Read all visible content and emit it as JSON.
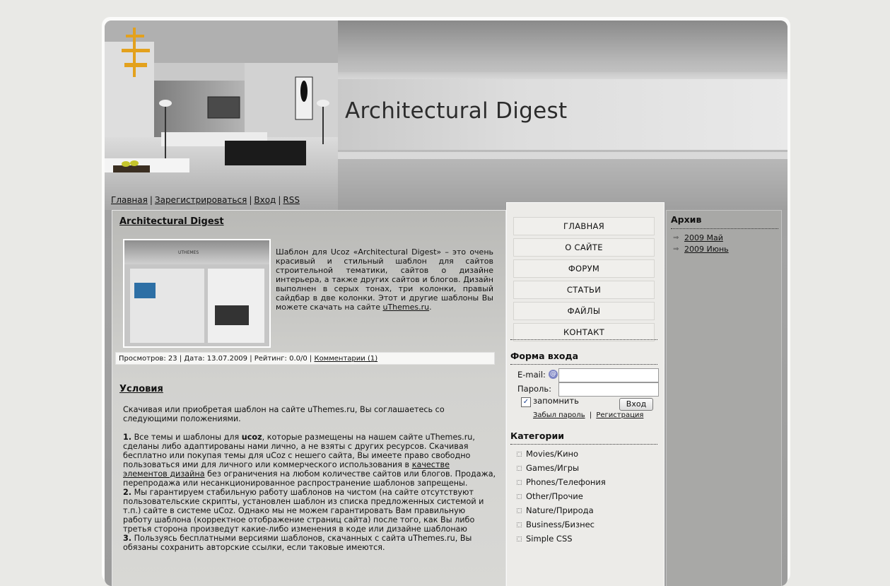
{
  "site": {
    "title": "Architectural Digest"
  },
  "topnav": {
    "items": [
      "Главная",
      "Зарегистрироваться",
      "Вход",
      "RSS"
    ],
    "sep": "|"
  },
  "entry": {
    "title": "Architectural Digest",
    "thumb_label": "UTHEMES",
    "text": "Шаблон для Ucoz «Architectural Digest» – это очень красивый и стильный шаблон для сайтов строительной тематики, сайтов о дизайне интерьера, а также других сайтов и блогов. Дизайн выполнен в серых тонах, три колонки, правый сайдбар в две колонки. Этот и другие шаблоны Вы можете скачать на сайте ",
    "text_link": "uThemes.ru",
    "text_end": ".",
    "meta_text": "Просмотров: 23 | Дата: 13.07.2009 | Рейтинг: 0.0/0 | ",
    "meta_link": "Комментарии (1)"
  },
  "terms": {
    "title": "Условия",
    "intro": "Скачивая или приобретая шаблон на сайте uThemes.ru, Вы соглашаетесь со следующими положениями.",
    "p1_num": "1.",
    "p1_a": " Все темы и шаблоны для ",
    "p1_bold": "ucoz",
    "p1_b": ", которые размещены на нашем сайте uThemes.ru, сделаны либо адаптированы нами лично, а не взяты с других ресурсов. Скачивая бесплатно или покупая темы для uCoz с нешего сайта, Вы имеете право свободно пользоваться ими для личного или коммерческого использования в ",
    "p1_link": "качестве элементов дизайна",
    "p1_c": " без ограничения на любом количестве сайтов или блогов. Продажа, перепродажа или несанкционированное распространение шаблонов запрещены.",
    "p2_num": "2.",
    "p2": " Мы гарантируем стабильную работу шаблонов на чистом (на сайте отсутствуют пользовательские скрипты, установлен шаблон из списка предложенных системой и т.п.) сайте в системе uCoz. Однако мы не можем гарантировать Вам правильную работу шаблона (корректное отображение страниц сайта) после того, как Вы либо третья сторона произведут какие-либо изменения в коде или дизайне шаблонаю",
    "p3_num": "3.",
    "p3": " Пользуясь бесплатными версиями шаблонов, скачанных с сайта uThemes.ru, Вы обязаны сохранить авторские ссылки, если таковые имеются."
  },
  "menu": {
    "items": [
      "ГЛАВНАЯ",
      "О САЙТЕ",
      "ФОРУМ",
      "СТАТЬИ",
      "ФАЙЛЫ",
      "КОНТАКТ"
    ]
  },
  "login": {
    "title": "Форма входа",
    "email_label": "E-mail:",
    "password_label": "Пароль:",
    "remember_label": "запомнить",
    "submit_label": "Вход",
    "forgot_label": "Забыл пароль",
    "register_label": "Регистрация",
    "sep": "|"
  },
  "categories": {
    "title": "Категории",
    "items": [
      "Movies/Кино",
      "Games/Игры",
      "Phones/Телефония",
      "Other/Прочие",
      "Nature/Природа",
      "Business/Бизнес",
      "Simple CSS"
    ]
  },
  "archive": {
    "title": "Архив",
    "items": [
      "2009 Май",
      "2009 Июнь"
    ]
  },
  "colors": {
    "page_bg": "#e9e9e6",
    "sidebar_bg": "#ecebe8",
    "right_bg": "#a8a8a6"
  },
  "icons": {
    "email_badge": "at-sign-icon",
    "checkbox": "checkmark-icon",
    "bullet": "dotted-square-icon",
    "archive_arrow": "arrow-icon"
  }
}
